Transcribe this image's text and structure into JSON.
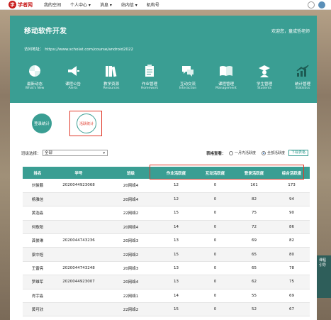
{
  "topbar": {
    "logo_text": "学者网",
    "logo_badge": "学",
    "nav": [
      "我的空间",
      "个人中心 ▾",
      "消息 ▾",
      "站内信 ▾",
      "机构号"
    ]
  },
  "header": {
    "course_title": "移动软件开发",
    "welcome": "欢迎您，童成哲老师",
    "url": "访问地址：   https://www.scholat.com/course/android2022"
  },
  "nav": [
    {
      "label": "最新动态",
      "sub": "What's New",
      "icon": "pinwheel-icon"
    },
    {
      "label": "课程公告",
      "sub": "Alerts",
      "icon": "megaphone-icon"
    },
    {
      "label": "教学资源",
      "sub": "Resources",
      "icon": "books-icon"
    },
    {
      "label": "作业管理",
      "sub": "Homework",
      "icon": "clipboard-icon"
    },
    {
      "label": "互动交流",
      "sub": "Interaction",
      "icon": "chat-icon"
    },
    {
      "label": "课程管理",
      "sub": "Management",
      "icon": "open-book-icon"
    },
    {
      "label": "学生管理",
      "sub": "Students",
      "icon": "graduate-icon"
    },
    {
      "label": "统计管理",
      "sub": "Statistics",
      "icon": "bar-chart-icon"
    }
  ],
  "tabs": {
    "login_stats": "登录统计",
    "activity_stats": "活跃统计"
  },
  "filters": {
    "class_label": "班级选择：",
    "class_value": "全部",
    "view_label": "表格查看：",
    "radio_month": "一月内活跃度",
    "radio_all": "全部活跃度",
    "download": "下载表格"
  },
  "table": {
    "headers": [
      "姓名",
      "学号",
      "班级",
      "作业活跃度",
      "互动活跃度",
      "登录活跃度",
      "综合活跃度"
    ],
    "rows": [
      [
        "刘俊鹏",
        "2020044923068",
        "20网络4",
        "12",
        "0",
        "161",
        "173"
      ],
      [
        "杨雅信",
        "",
        "20网络4",
        "12",
        "0",
        "82",
        "94"
      ],
      [
        "黄浩淼",
        "",
        "22网络2",
        "15",
        "0",
        "75",
        "90"
      ],
      [
        "何歌阳",
        "",
        "20网络4",
        "14",
        "0",
        "72",
        "86"
      ],
      [
        "龚俊琳",
        "2020044743236",
        "20网络3",
        "13",
        "0",
        "69",
        "82"
      ],
      [
        "梁中旭",
        "",
        "22网络2",
        "15",
        "0",
        "65",
        "80"
      ],
      [
        "王雷亮",
        "2020044743248",
        "20网络3",
        "13",
        "0",
        "65",
        "78"
      ],
      [
        "罗维军",
        "2020044923007",
        "20网络4",
        "13",
        "0",
        "62",
        "75"
      ],
      [
        "肖宇淼",
        "",
        "22网络1",
        "14",
        "0",
        "55",
        "69"
      ],
      [
        "黄可欣",
        "",
        "22网络2",
        "15",
        "0",
        "52",
        "67"
      ]
    ]
  },
  "side_strip": "课程 引导",
  "colors": {
    "teal": "#3a9e93",
    "highlight_red": "#e03a2a",
    "logo_red": "#c81c1c"
  }
}
